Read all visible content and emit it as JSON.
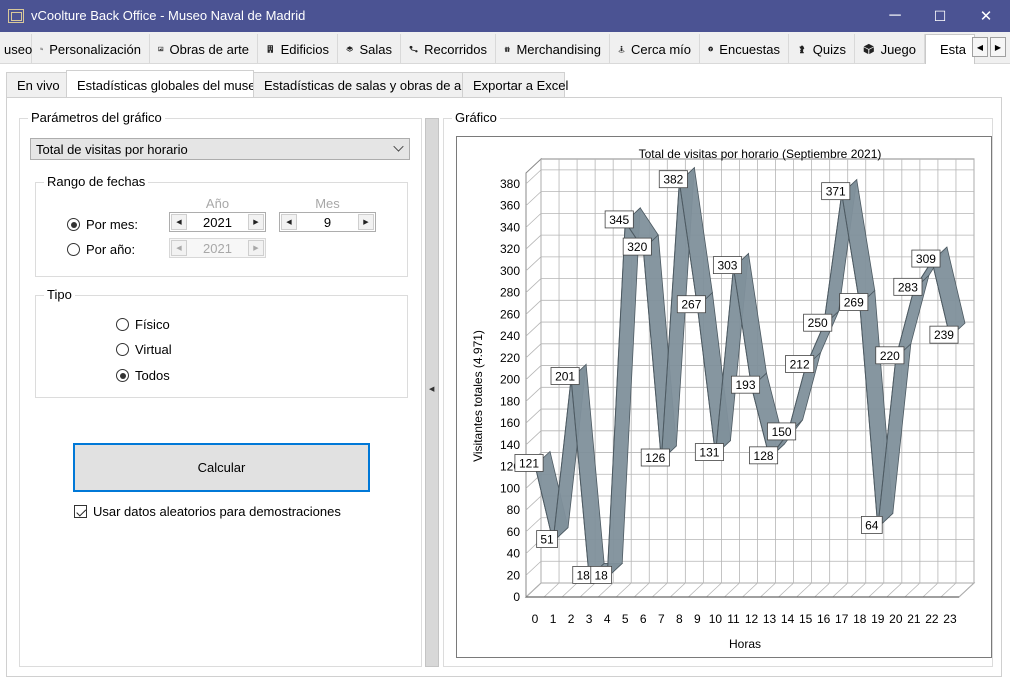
{
  "window": {
    "title": "vCoolture Back Office - Museo Naval de Madrid",
    "buttons": {
      "minimize": "─",
      "maximize": "☐",
      "close": "✕"
    }
  },
  "top_tabs": [
    {
      "label": "useo",
      "icon": ""
    },
    {
      "label": "Personalización",
      "icon": "sliders-icon"
    },
    {
      "label": "Obras de arte",
      "icon": "image-icon"
    },
    {
      "label": "Edificios",
      "icon": "building-icon"
    },
    {
      "label": "Salas",
      "icon": "cube-icon"
    },
    {
      "label": "Recorridos",
      "icon": "route-icon"
    },
    {
      "label": "Merchandising",
      "icon": "gift-icon"
    },
    {
      "label": "Cerca mío",
      "icon": "person-location-icon"
    },
    {
      "label": "Encuestas",
      "icon": "question-icon"
    },
    {
      "label": "Quizs",
      "icon": "chess-icon"
    },
    {
      "label": "Juego",
      "icon": "box-icon"
    },
    {
      "label": "Esta",
      "icon": "bar-chart-icon"
    }
  ],
  "sub_tabs": [
    {
      "label": "En vivo"
    },
    {
      "label": "Estadísticas globales del museo"
    },
    {
      "label": "Estadísticas de salas y obras de arte"
    },
    {
      "label": "Exportar a Excel"
    }
  ],
  "params": {
    "group_label": "Parámetros del gráfico",
    "chart_type_selected": "Total de visitas por horario",
    "range": {
      "group_label": "Rango de fechas",
      "year_header": "Año",
      "month_header": "Mes",
      "by_month_label": "Por mes:",
      "by_year_label": "Por año:",
      "year_value": "2021",
      "month_value": "9",
      "year_only_value": "2021",
      "selected": "by_month"
    },
    "type": {
      "group_label": "Tipo",
      "options": [
        "Físico",
        "Virtual",
        "Todos"
      ],
      "selected": "Todos"
    },
    "calc_button": "Calcular",
    "random_data_label": "Usar datos aleatorios para demostraciones",
    "random_data_checked": true
  },
  "chart_panel": {
    "group_label": "Gráfico"
  },
  "chart_data": {
    "type": "line",
    "style": "3d-ribbon",
    "title": "Total de visitas por horario (Septiembre 2021)",
    "xlabel": "Horas",
    "ylabel": "Visitantes totales  (4.971)",
    "x": [
      0,
      1,
      2,
      3,
      4,
      5,
      6,
      7,
      8,
      9,
      10,
      11,
      12,
      13,
      14,
      15,
      16,
      17,
      18,
      19,
      20,
      21,
      22,
      23
    ],
    "values": [
      121,
      51,
      201,
      18,
      18,
      345,
      320,
      126,
      382,
      267,
      131,
      303,
      193,
      128,
      150,
      212,
      250,
      371,
      269,
      64,
      220,
      283,
      309,
      239
    ],
    "ylim": [
      0,
      390
    ],
    "yticks": [
      0,
      20,
      40,
      60,
      80,
      100,
      120,
      140,
      160,
      180,
      200,
      220,
      240,
      260,
      280,
      300,
      320,
      340,
      360,
      380
    ],
    "grid": true,
    "series_color": "#7f909b"
  }
}
